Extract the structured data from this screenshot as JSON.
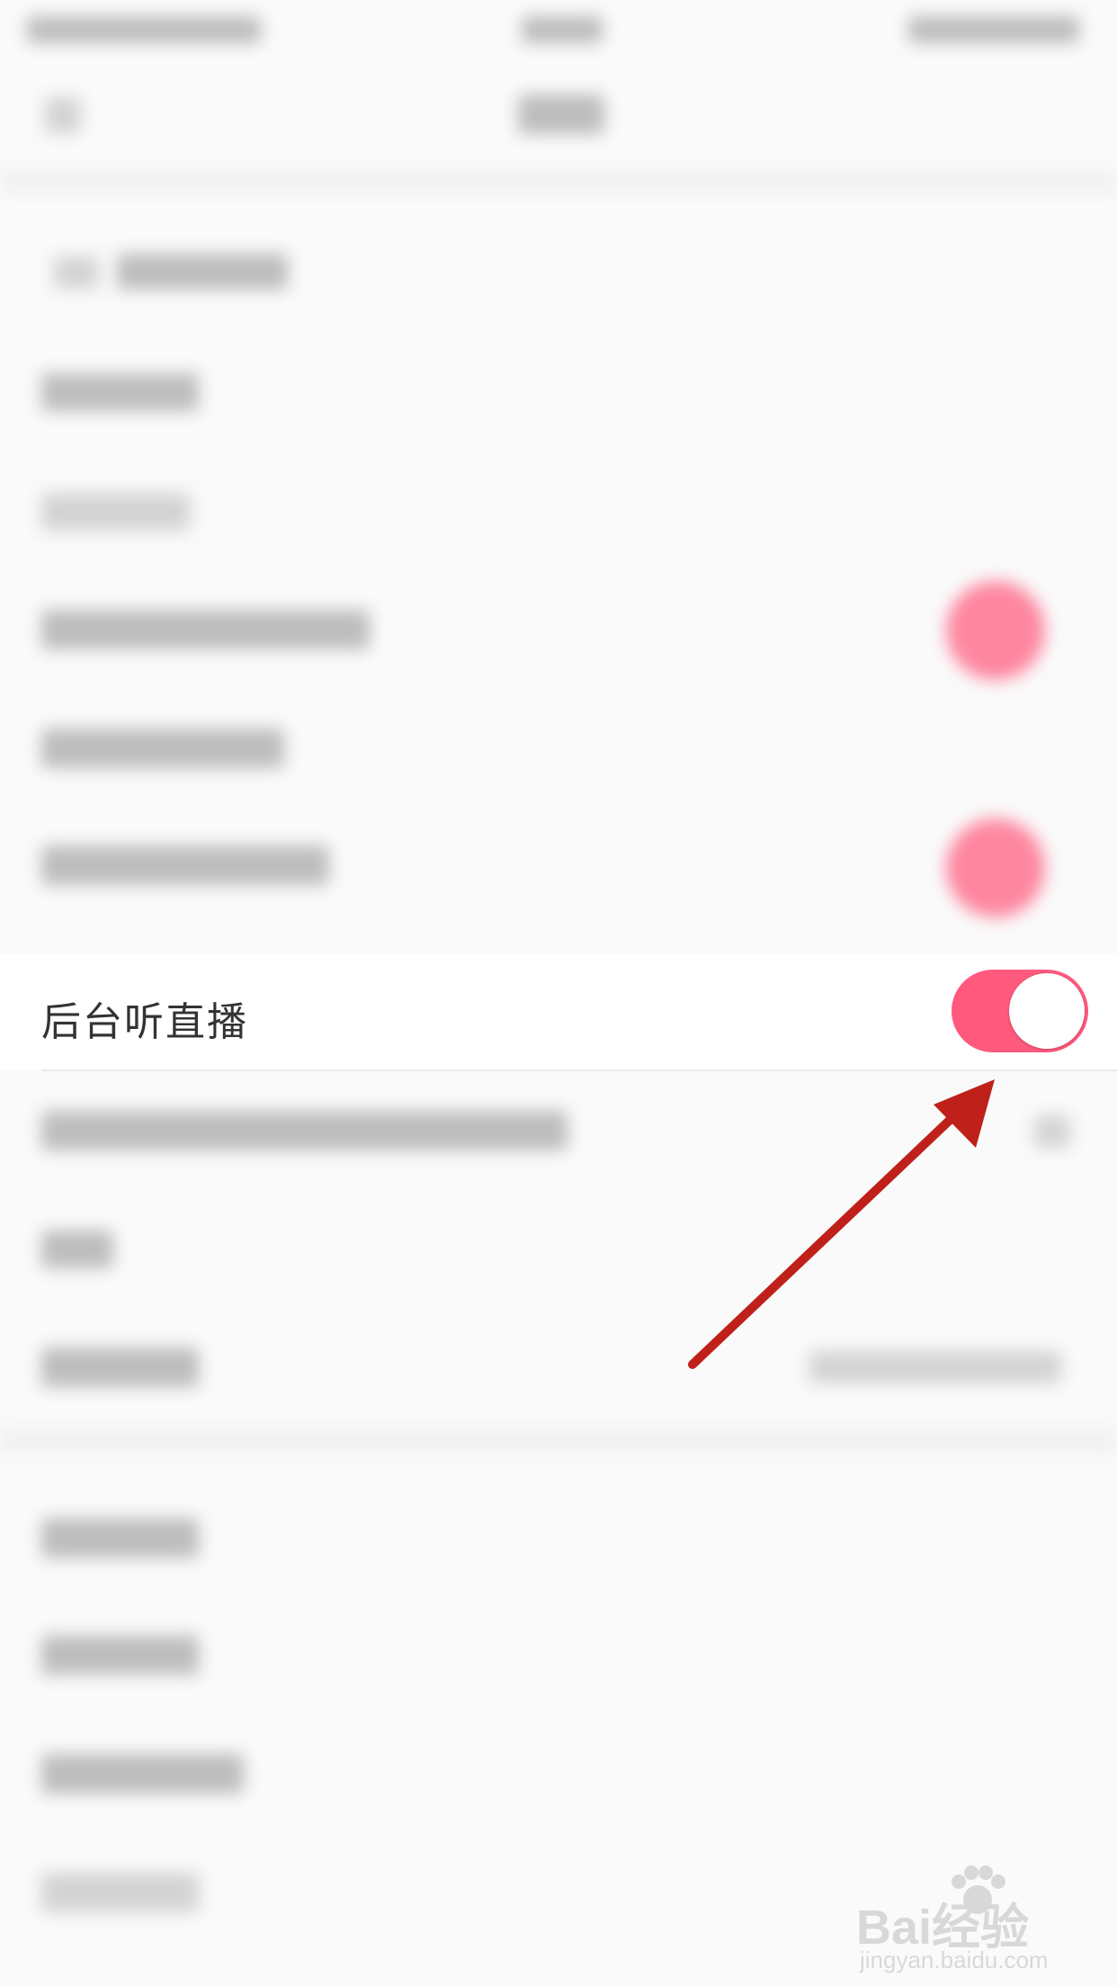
{
  "setting": {
    "label": "后台听直播",
    "toggle_on": true
  },
  "colors": {
    "toggle_active": "#ff5a7e",
    "arrow": "#c0201a",
    "background": "#fafafa"
  },
  "watermark": {
    "brand": "Bai经验",
    "url": "jingyan.baidu.com"
  },
  "icons": [
    "baidu-paw-icon",
    "arrow-annotation"
  ]
}
